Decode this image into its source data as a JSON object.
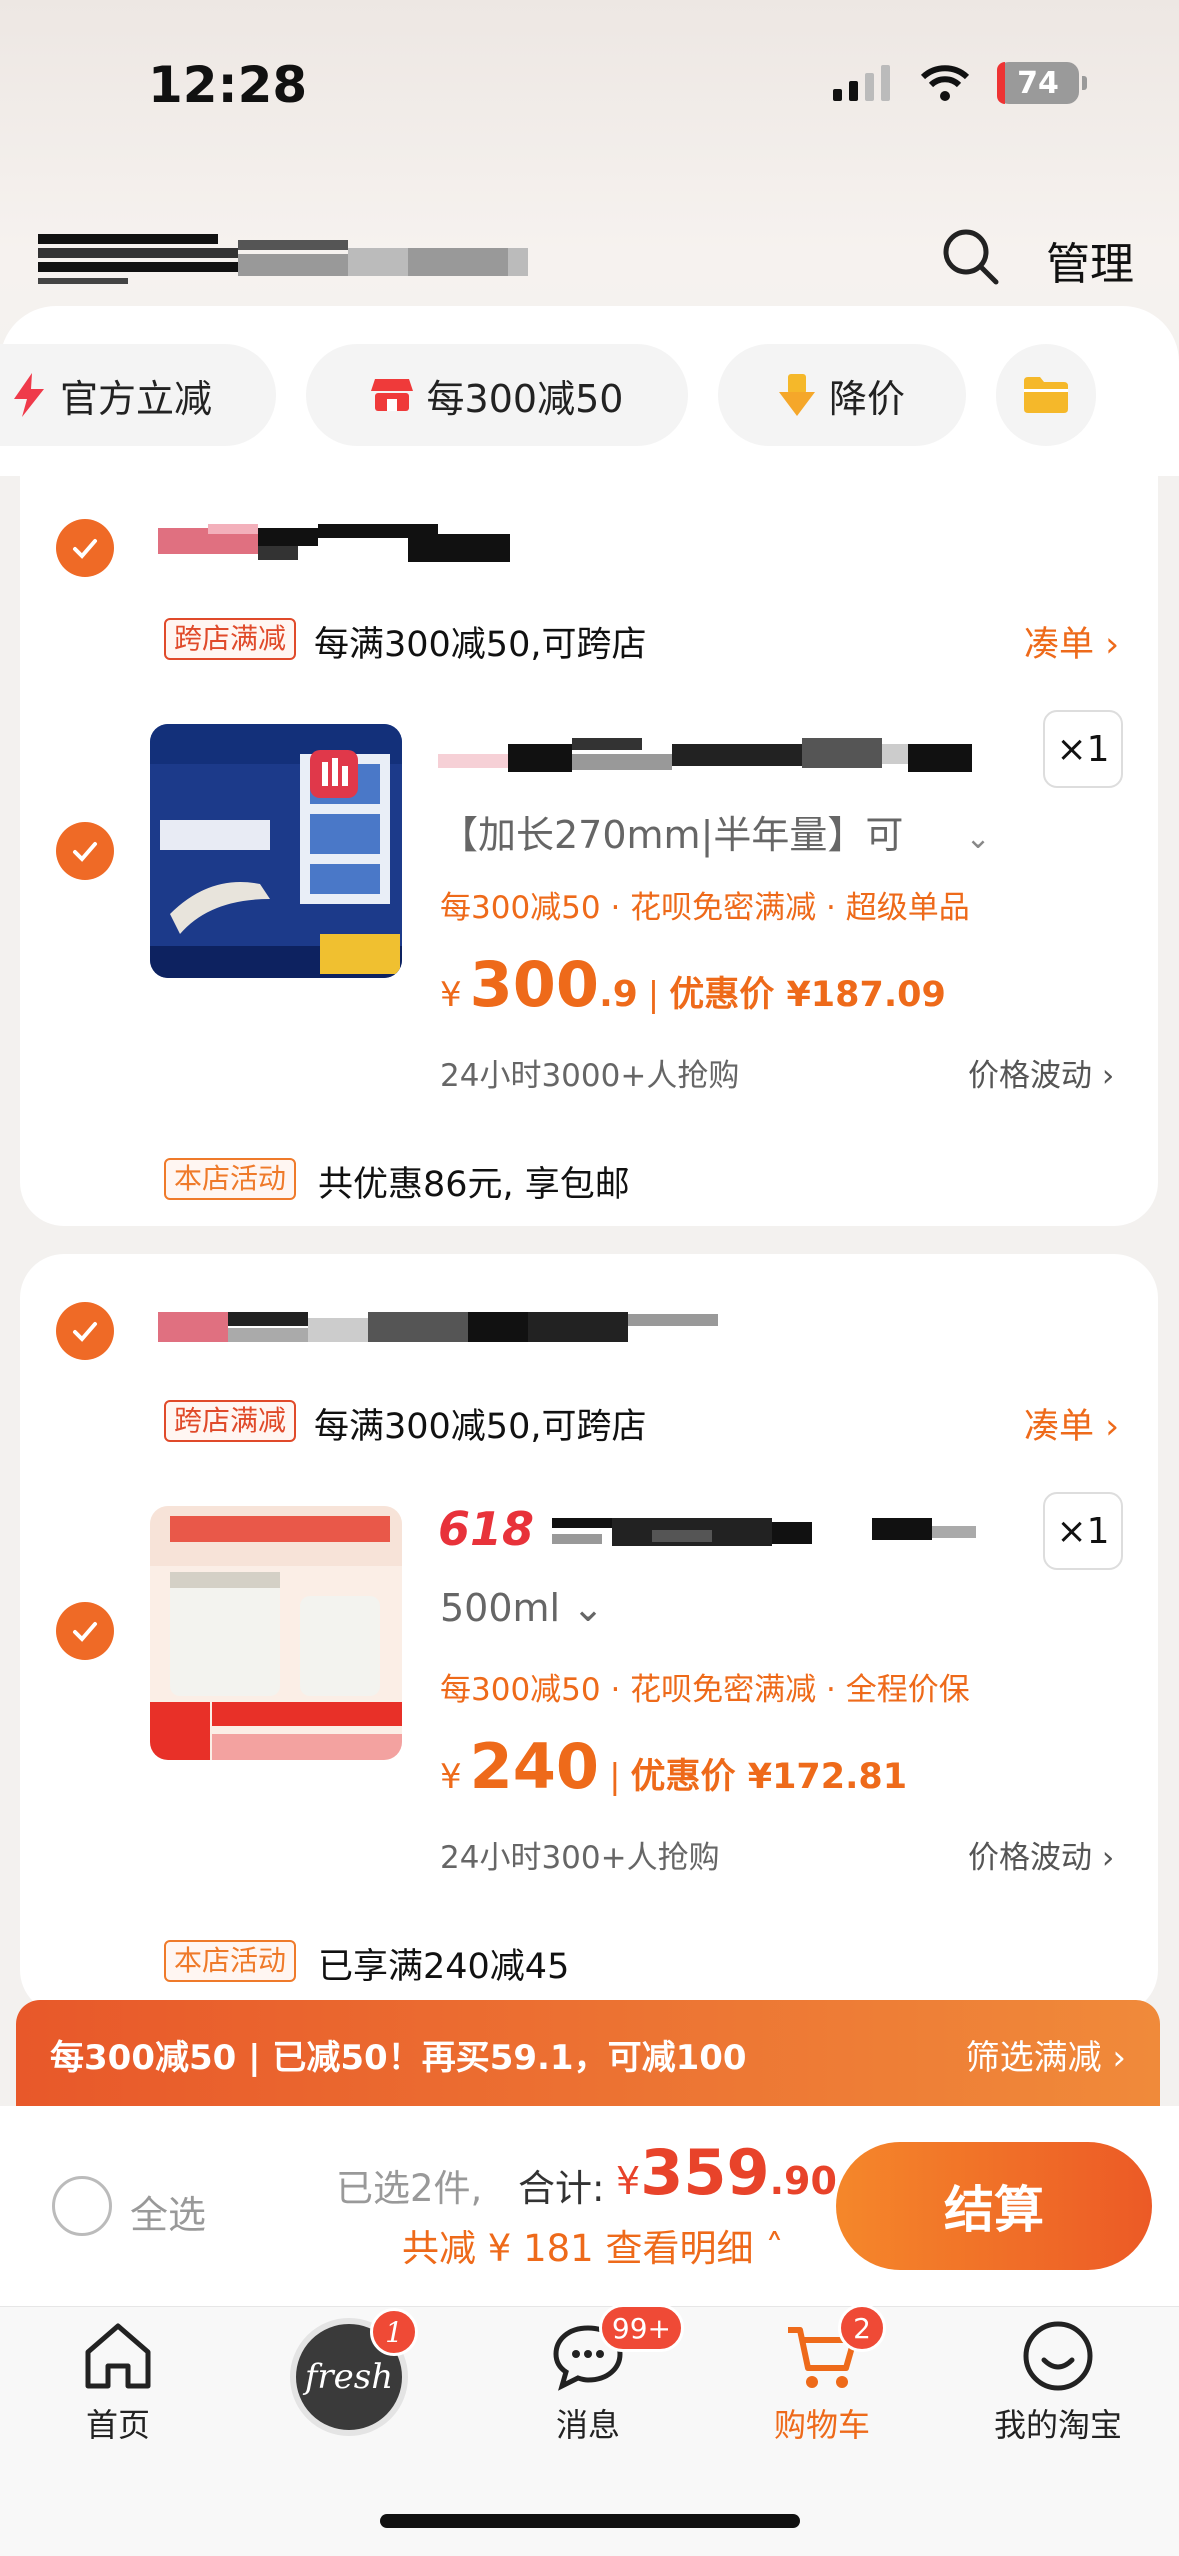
{
  "status_bar": {
    "time": "12:28",
    "battery": "74"
  },
  "header": {
    "manage_label": "管理"
  },
  "filter_chips": [
    {
      "label": "官方立减"
    },
    {
      "label": "每300减50"
    },
    {
      "label": "降价"
    }
  ],
  "stores": [
    {
      "promo_tag": "跨店满减",
      "promo_text": "每满300减50,可跨店",
      "coudan_label": "凑单 ›",
      "item": {
        "sku": "【加长270mm|半年量】可",
        "quantity": "×1",
        "benefits": "每300减50 · 花呗免密满减 · 超级单品",
        "price_currency": "¥",
        "price_int": "300",
        "price_dec": ".9",
        "discount_label": "优惠价 ¥187.09",
        "sales": "24小时3000+人抢购",
        "price_wave": "价格波动 ›"
      },
      "store_tag": "本店活动",
      "store_text": "共优惠86元, 享包邮"
    },
    {
      "promo_tag": "跨店满减",
      "promo_text": "每满300减50,可跨店",
      "coudan_label": "凑单 ›",
      "item": {
        "tag": "618",
        "sku": "500ml ⌄",
        "quantity": "×1",
        "benefits": "每300减50 · 花呗免密满减 · 全程价保",
        "price_currency": "¥",
        "price_int": "240",
        "price_dec": "",
        "discount_label": "优惠价 ¥172.81",
        "sales": "24小时300+人抢购",
        "price_wave": "价格波动 ›"
      },
      "store_tag": "本店活动",
      "store_text": "已享满240减45"
    }
  ],
  "banner": {
    "text": "每300减50 | 已减50！再买59.1，可减100",
    "filter_label": "筛选满减 ›"
  },
  "checkout": {
    "select_all": "全选",
    "selected_count": "已选2件,",
    "total_label": "合计:",
    "total_currency": "¥",
    "total_int": "359",
    "total_dec": ".90",
    "saved_text": "共减 ¥ 181  查看明细 ˄",
    "pay_label": "结算"
  },
  "tabbar": [
    {
      "label": "首页",
      "icon": "home-icon"
    },
    {
      "label": "fresh",
      "icon": "fresh-avatar",
      "badge": "1"
    },
    {
      "label": "消息",
      "icon": "message-icon",
      "badge": "99+"
    },
    {
      "label": "购物车",
      "icon": "cart-icon",
      "badge": "2",
      "active": true
    },
    {
      "label": "我的淘宝",
      "icon": "smile-icon"
    }
  ],
  "colors": {
    "accent": "#ee6a1a",
    "checkmark": "#ef6a26",
    "badge": "#ef4a36"
  }
}
